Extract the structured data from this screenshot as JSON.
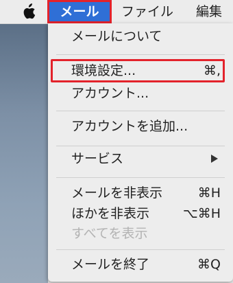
{
  "menubar": {
    "apple_icon": "apple-icon",
    "active_menu": "メール",
    "file_menu": "ファイル",
    "edit_menu": "編集"
  },
  "menu": {
    "items": [
      {
        "label": "メールについて",
        "shortcut": ""
      },
      {
        "label": "環境設定...",
        "shortcut": "⌘,"
      },
      {
        "label": "アカウント...",
        "shortcut": ""
      },
      {
        "label": "アカウントを追加...",
        "shortcut": ""
      },
      {
        "label": "サービス",
        "shortcut": "",
        "submenu": true
      },
      {
        "label": "メールを非表示",
        "shortcut": "⌘H"
      },
      {
        "label": "ほかを非表示",
        "shortcut": "⌥⌘H"
      },
      {
        "label": "すべてを表示",
        "shortcut": "",
        "disabled": true
      },
      {
        "label": "メールを終了",
        "shortcut": "⌘Q"
      }
    ]
  },
  "colors": {
    "accent": "#2f6fd6",
    "highlight_border": "#e3222b"
  }
}
